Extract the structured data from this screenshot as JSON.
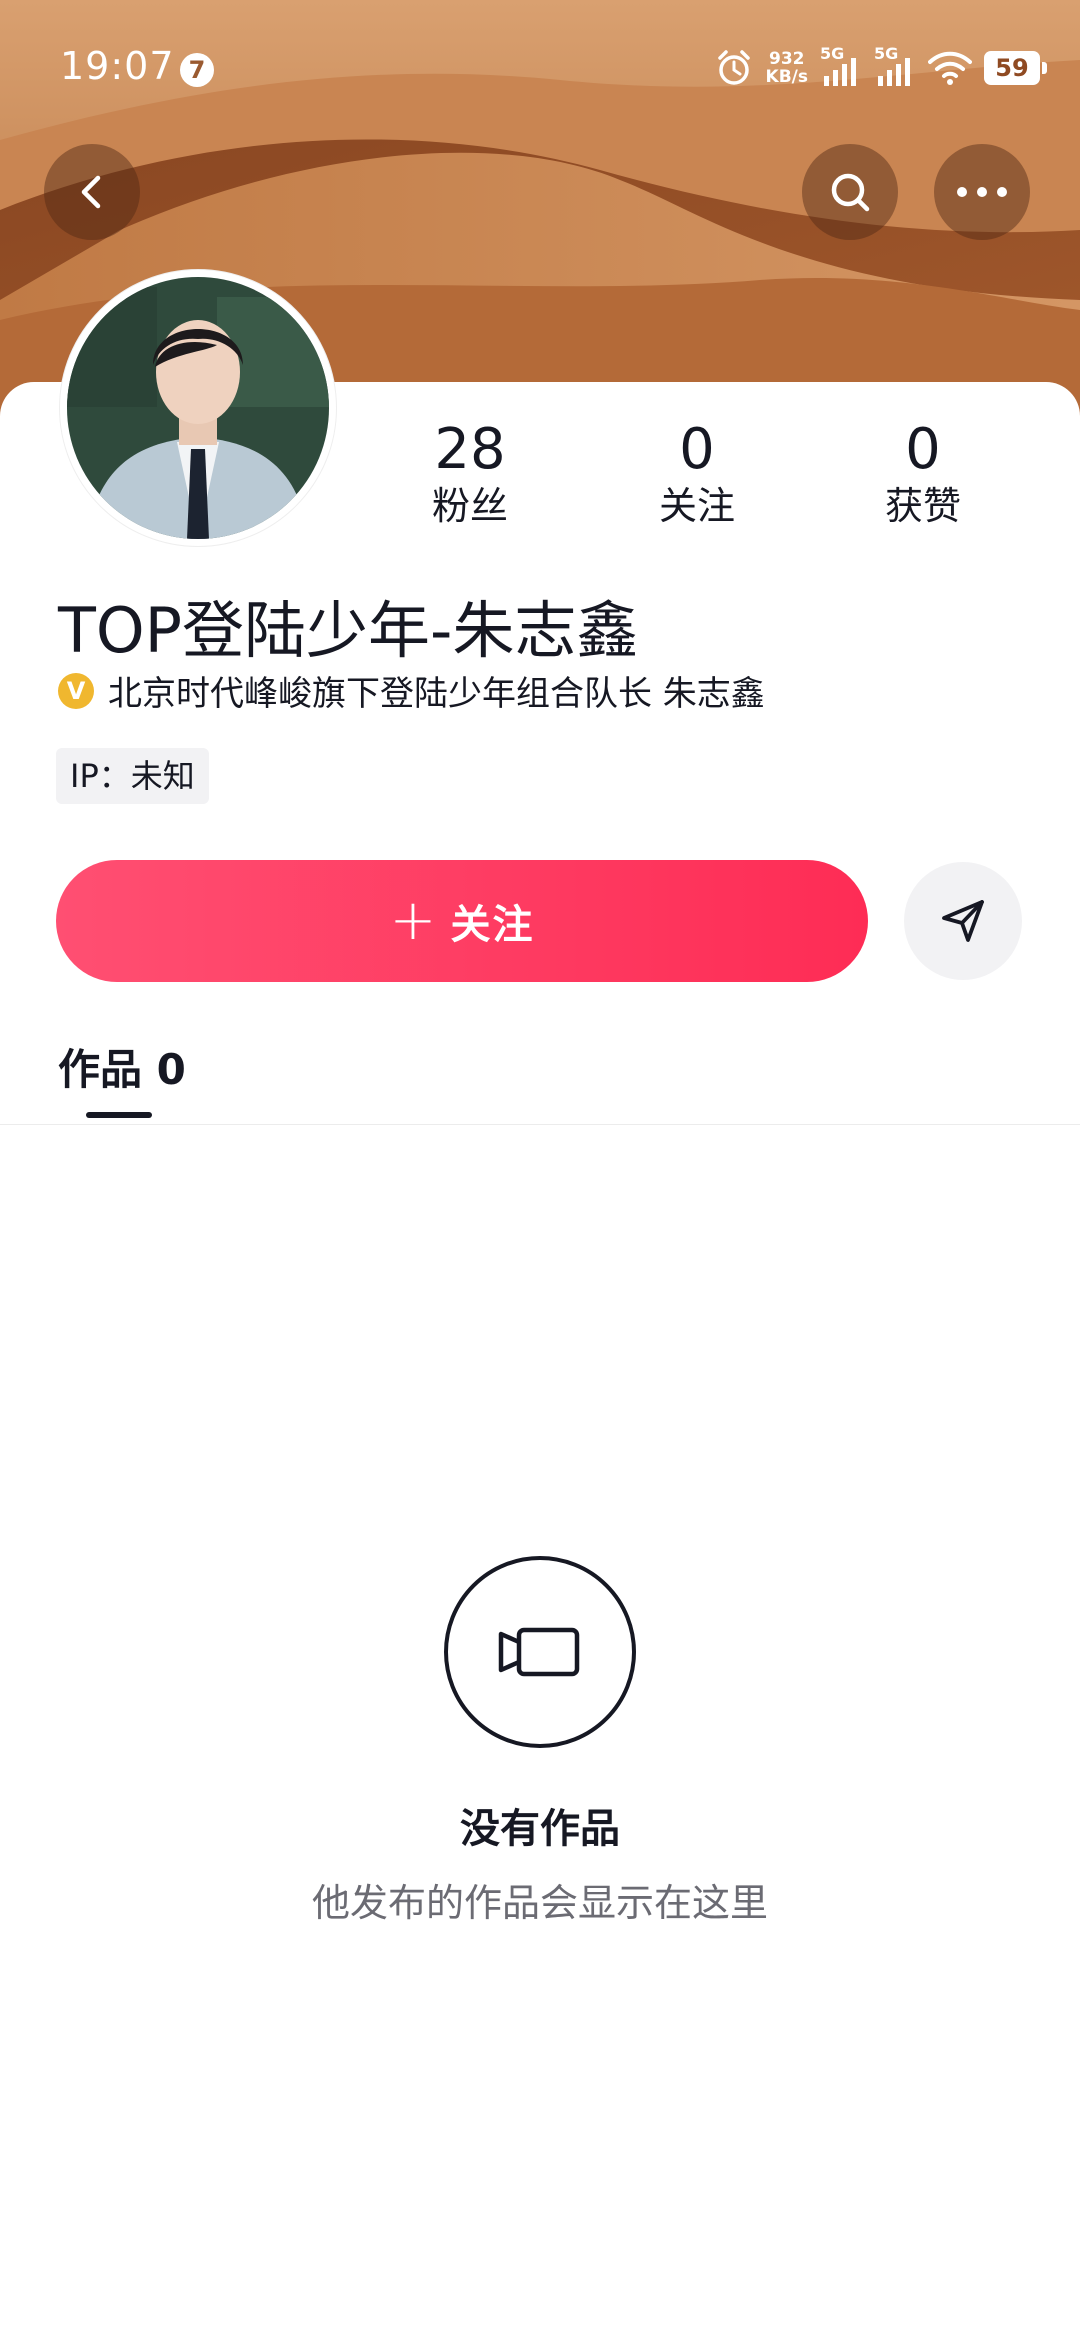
{
  "status_bar": {
    "time": "19:07",
    "notification_count": "7",
    "speed_value": "932",
    "speed_unit": "KB/s",
    "net1": "5G",
    "net2": "5G",
    "battery": "59"
  },
  "header": {
    "back_icon": "chevron-left-icon",
    "search_icon": "search-icon",
    "more_icon": "more-horizontal-icon"
  },
  "profile": {
    "name": "TOP登陆少年-朱志鑫",
    "verified_badge": "V",
    "verified_text": "北京时代峰峻旗下登陆少年组合队长 朱志鑫",
    "ip_label": "IP：未知",
    "stats": [
      {
        "value": "28",
        "label": "粉丝"
      },
      {
        "value": "0",
        "label": "关注"
      },
      {
        "value": "0",
        "label": "获赞"
      }
    ]
  },
  "actions": {
    "follow_plus": "+",
    "follow_label": "关注",
    "share_icon": "send-icon"
  },
  "tabs": [
    {
      "label": "作品 0",
      "active": true
    }
  ],
  "empty_state": {
    "icon": "video-camera-icon",
    "title": "没有作品",
    "subtitle": "他发布的作品会显示在这里"
  },
  "colors": {
    "accent": "#fe2c55",
    "banner": "#b8703f",
    "verified": "#f0b72f"
  }
}
